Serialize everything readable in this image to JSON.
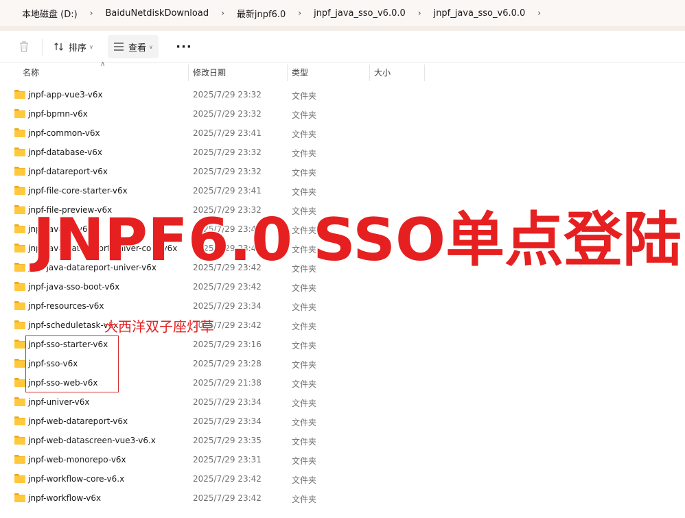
{
  "breadcrumb": [
    "本地磁盘 (D:)",
    "BaiduNetdiskDownload",
    "最新jnpf6.0",
    "jnpf_java_sso_v6.0.0",
    "jnpf_java_sso_v6.0.0"
  ],
  "toolbar": {
    "sort_label": "排序",
    "view_label": "查看",
    "more_label": "···"
  },
  "columns": {
    "name": "名称",
    "date": "修改日期",
    "type": "类型",
    "size": "大小"
  },
  "files": [
    {
      "name": "jnpf-app-vue3-v6x",
      "date": "2025/7/29 23:32",
      "type": "文件夹"
    },
    {
      "name": "jnpf-bpmn-v6x",
      "date": "2025/7/29 23:32",
      "type": "文件夹"
    },
    {
      "name": "jnpf-common-v6x",
      "date": "2025/7/29 23:41",
      "type": "文件夹"
    },
    {
      "name": "jnpf-database-v6x",
      "date": "2025/7/29 23:32",
      "type": "文件夹"
    },
    {
      "name": "jnpf-datareport-v6x",
      "date": "2025/7/29 23:32",
      "type": "文件夹"
    },
    {
      "name": "jnpf-file-core-starter-v6x",
      "date": "2025/7/29 23:41",
      "type": "文件夹"
    },
    {
      "name": "jnpf-file-preview-v6x",
      "date": "2025/7/29 23:32",
      "type": "文件夹"
    },
    {
      "name": "jnpf-java-…-v6",
      "date": "2025/7/29 23:41",
      "type": "文件夹"
    },
    {
      "name": "jnpf-java-datareport-univer-core-v6x",
      "date": "2025/7/29 23:43",
      "type": "文件夹"
    },
    {
      "name": "jnpf-java-datareport-univer-v6x",
      "date": "2025/7/29 23:42",
      "type": "文件夹"
    },
    {
      "name": "jnpf-java-sso-boot-v6x",
      "date": "2025/7/29 23:42",
      "type": "文件夹"
    },
    {
      "name": "jnpf-resources-v6x",
      "date": "2025/7/29 23:34",
      "type": "文件夹"
    },
    {
      "name": "jnpf-scheduletask-v6x",
      "date": "2025/7/29 23:42",
      "type": "文件夹"
    },
    {
      "name": "jnpf-sso-starter-v6x",
      "date": "2025/7/29 23:16",
      "type": "文件夹"
    },
    {
      "name": "jnpf-sso-v6x",
      "date": "2025/7/29 23:28",
      "type": "文件夹"
    },
    {
      "name": "jnpf-sso-web-v6x",
      "date": "2025/7/29 21:38",
      "type": "文件夹"
    },
    {
      "name": "jnpf-univer-v6x",
      "date": "2025/7/29 23:34",
      "type": "文件夹"
    },
    {
      "name": "jnpf-web-datareport-v6x",
      "date": "2025/7/29 23:34",
      "type": "文件夹"
    },
    {
      "name": "jnpf-web-datascreen-vue3-v6.x",
      "date": "2025/7/29 23:35",
      "type": "文件夹"
    },
    {
      "name": "jnpf-web-monorepo-v6x",
      "date": "2025/7/29 23:31",
      "type": "文件夹"
    },
    {
      "name": "jnpf-workflow-core-v6.x",
      "date": "2025/7/29 23:42",
      "type": "文件夹"
    },
    {
      "name": "jnpf-workflow-v6x",
      "date": "2025/7/29 23:42",
      "type": "文件夹"
    }
  ],
  "overlay": {
    "title": "JNPF6.0 SSO单点登陆",
    "subtitle": "大西洋双子座灯草"
  },
  "colors": {
    "accent": "#e62020",
    "folder": "#ffc83d",
    "highlight_border": "#d42b2b"
  },
  "icons": {
    "delete": "trash-icon",
    "sort": "sort-icon",
    "view": "view-list-icon",
    "folder": "folder-icon"
  }
}
